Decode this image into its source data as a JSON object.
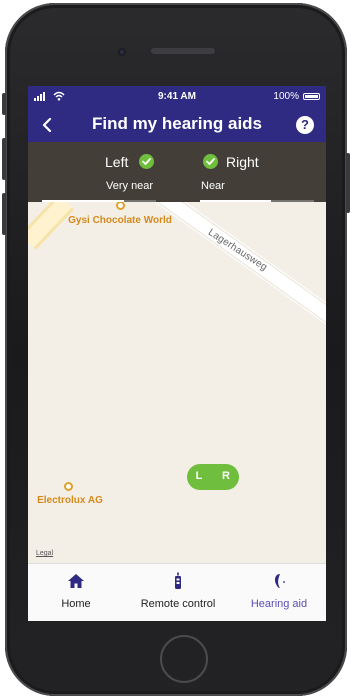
{
  "status_bar": {
    "time": "9:41 AM",
    "battery": "100%"
  },
  "header": {
    "title": "Find my hearing aids",
    "help_glyph": "?"
  },
  "signal": {
    "left": {
      "name": "Left",
      "status": "Very near",
      "strength": 0.72
    },
    "right": {
      "name": "Right",
      "status": "Near",
      "strength": 0.62
    }
  },
  "map": {
    "pois": [
      "Gysi Chocolate World",
      "Electrolux AG"
    ],
    "street": "Lagerhausweg",
    "legal": "Legal",
    "marker": {
      "left": "L",
      "right": "R"
    }
  },
  "tabs": [
    {
      "label": "Home",
      "icon": "home-icon",
      "active": false
    },
    {
      "label": "Remote control",
      "icon": "remote-icon",
      "active": false
    },
    {
      "label": "Hearing aid",
      "icon": "hearing-aid-icon",
      "active": true
    }
  ],
  "colors": {
    "header_bg": "#2f2a82",
    "panel_bg": "#37342d",
    "check_green": "#6fbe3e",
    "marker_green": "#6fbe3e",
    "active_tab": "#5a4fb8",
    "poi_orange": "#d58a1c"
  }
}
